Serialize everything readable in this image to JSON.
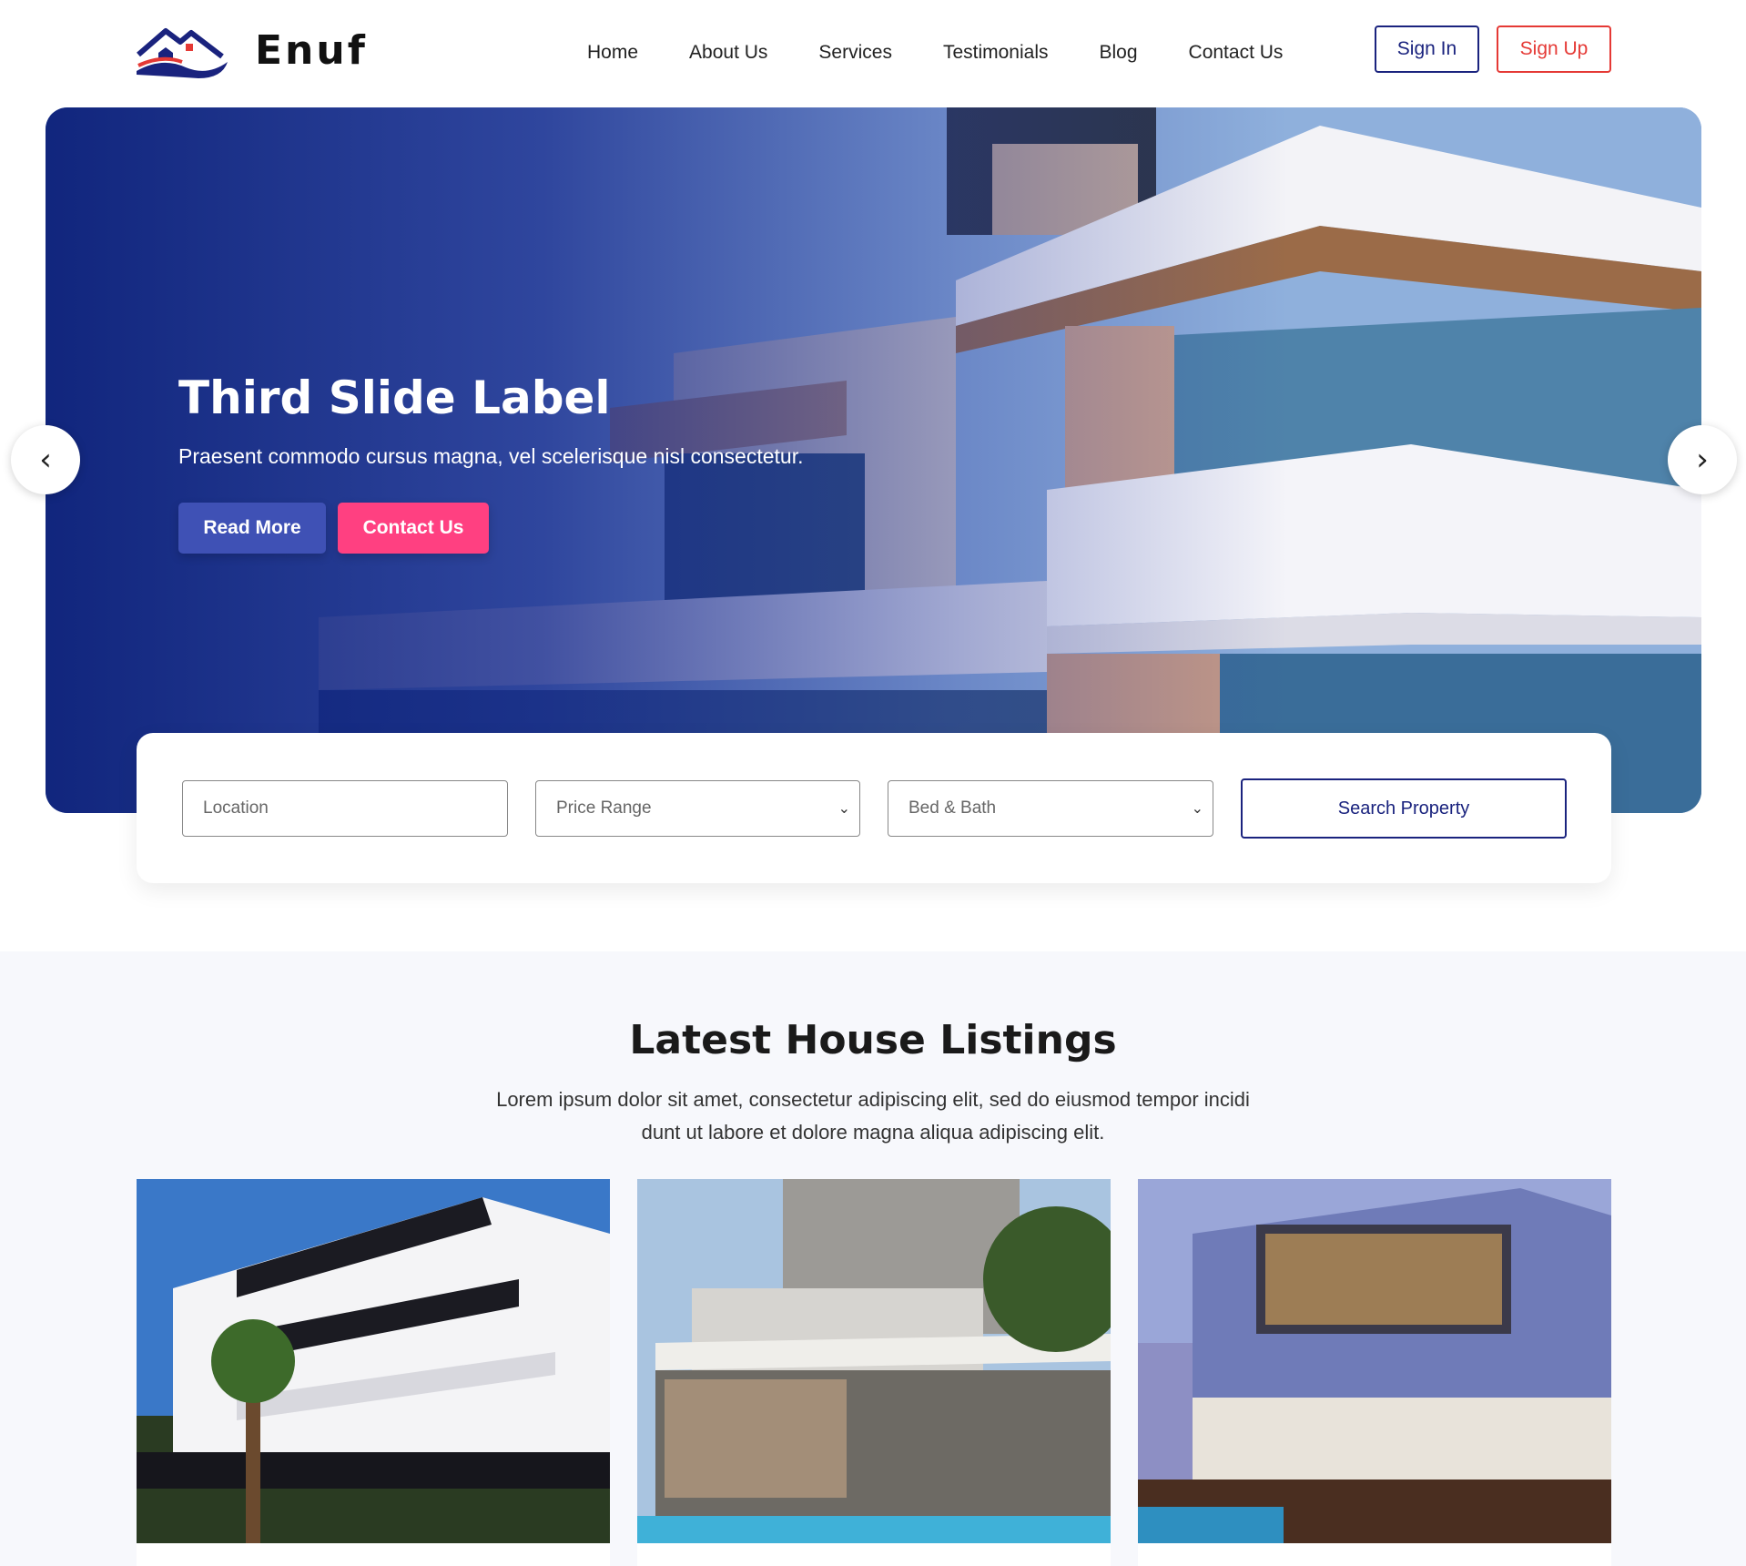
{
  "brand": {
    "name": "Enuf"
  },
  "nav": {
    "items": [
      "Home",
      "About Us",
      "Services",
      "Testimonials",
      "Blog",
      "Contact Us"
    ]
  },
  "auth": {
    "sign_in": "Sign In",
    "sign_up": "Sign Up"
  },
  "hero": {
    "title": "Third Slide Label",
    "subtitle": "Praesent commodo cursus magna, vel scelerisque nisl consectetur.",
    "read_more": "Read More",
    "contact": "Contact Us",
    "prev_icon": "chevron-left-icon",
    "next_icon": "chevron-right-icon"
  },
  "search": {
    "location_placeholder": "Location",
    "price_range": "Price Range",
    "bed_bath": "Bed & Bath",
    "button": "Search Property"
  },
  "listings": {
    "title": "Latest House Listings",
    "description": "Lorem ipsum dolor sit amet, consectetur adipiscing elit, sed do eiusmod tempor incidi dunt ut labore et dolore magna aliqua adipiscing elit."
  },
  "colors": {
    "primary": "#1a237e",
    "accent_red": "#e53935",
    "read_more_bg": "#3f51b5",
    "contact_bg": "#ff4081",
    "section_bg": "#f7f8fc"
  }
}
